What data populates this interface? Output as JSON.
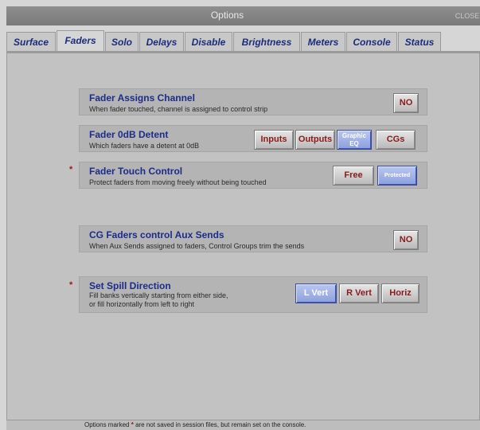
{
  "window": {
    "title": "Options",
    "close_label": "CLOSE"
  },
  "tabs": [
    "Surface",
    "Faders",
    "Solo",
    "Delays",
    "Disable",
    "Brightness",
    "Meters",
    "Console",
    "Status"
  ],
  "active_tab": "Faders",
  "settings": {
    "fader_assigns": {
      "title": "Fader Assigns Channel",
      "desc": "When fader touched, channel is assigned to control strip",
      "button": "NO"
    },
    "fader_detent": {
      "title": "Fader 0dB Detent",
      "desc": "Which faders have a detent at 0dB",
      "buttons": [
        "Inputs",
        "Outputs",
        "Graphic EQ",
        "CGs"
      ],
      "selected": "Graphic EQ"
    },
    "fader_touch": {
      "title": "Fader Touch Control",
      "desc": "Protect faders from moving freely without being touched",
      "buttons": [
        "Free",
        "Protected"
      ],
      "selected": "Protected"
    },
    "cg_faders": {
      "title": "CG Faders control Aux Sends",
      "desc": "When Aux Sends assigned to faders, Control Groups trim the sends",
      "button": "NO"
    },
    "spill": {
      "title": "Set Spill Direction",
      "desc_line1": "Fill banks vertically starting from either side,",
      "desc_line2": "or fill horizontally from left to right",
      "buttons": [
        "L Vert",
        "R Vert",
        "Horiz"
      ],
      "selected": "L Vert"
    }
  },
  "star_marker": "*",
  "footer": {
    "before": "Options marked",
    "mark": "*",
    "after": "are not saved in session files, but remain set on the console."
  },
  "colors": {
    "label_blue": "#1c2c8a",
    "star_red": "#a01818",
    "selected_btn": "#8aa0de"
  }
}
